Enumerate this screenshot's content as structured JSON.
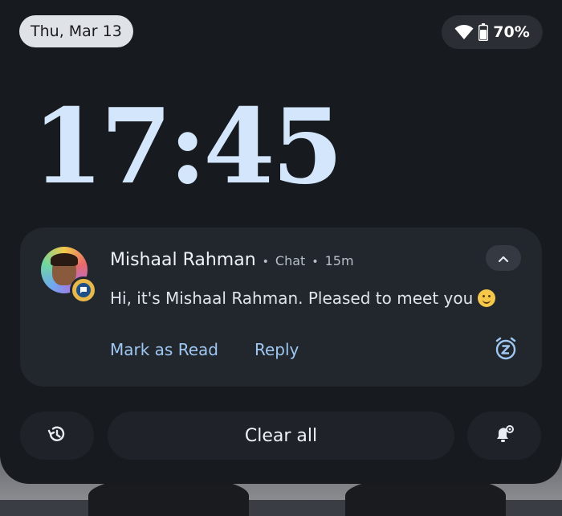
{
  "status_bar": {
    "date": "Thu, Mar 13",
    "battery_percent": "70%",
    "wifi_icon": "wifi-icon",
    "battery_icon": "battery-icon"
  },
  "clock": {
    "time": "17:45"
  },
  "notification": {
    "app_icon": "chat-badge-icon",
    "sender": "Mishaal Rahman",
    "app_name": "Chat",
    "time_ago": "15m",
    "message": "Hi, it's Mishaal Rahman. Pleased to meet you",
    "emoji": "slightly-smiling-face",
    "actions": [
      {
        "label": "Mark as Read"
      },
      {
        "label": "Reply"
      }
    ],
    "snooze_icon": "snooze-icon",
    "expand_icon": "chevron-up-icon"
  },
  "bottom_bar": {
    "clear_all_label": "Clear all",
    "history_icon": "history-icon",
    "settings_icon": "notification-settings-icon"
  },
  "colors": {
    "shade_bg": "#171a1f",
    "card_bg": "#22272e",
    "accent_text": "#9fc7f2",
    "clock_color": "#d3e6fb"
  }
}
